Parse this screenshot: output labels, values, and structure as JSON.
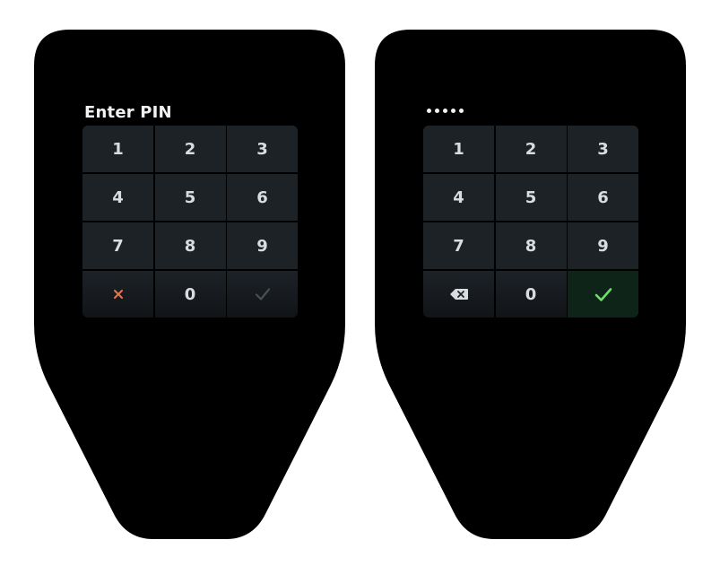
{
  "screens": {
    "entry": {
      "prompt": "Enter PIN",
      "keys": [
        "1",
        "2",
        "3",
        "4",
        "5",
        "6",
        "7",
        "8",
        "9"
      ],
      "zero": "0",
      "cancel_icon": "close-icon",
      "confirm_icon": "checkmark-icon",
      "confirm_enabled": false
    },
    "filled": {
      "pin_dot_count": 5,
      "keys": [
        "1",
        "2",
        "3",
        "4",
        "5",
        "6",
        "7",
        "8",
        "9"
      ],
      "zero": "0",
      "delete_icon": "backspace-icon",
      "confirm_icon": "checkmark-icon",
      "confirm_enabled": true
    }
  },
  "colors": {
    "device_body": "#000000",
    "key_bg": "#1d2227",
    "key_text": "#d9dde0",
    "cancel_accent": "#e8734f",
    "confirm_disabled": "#4a4f54",
    "confirm_active": "#6fdc6c",
    "confirm_active_bg": "#0f2418"
  }
}
